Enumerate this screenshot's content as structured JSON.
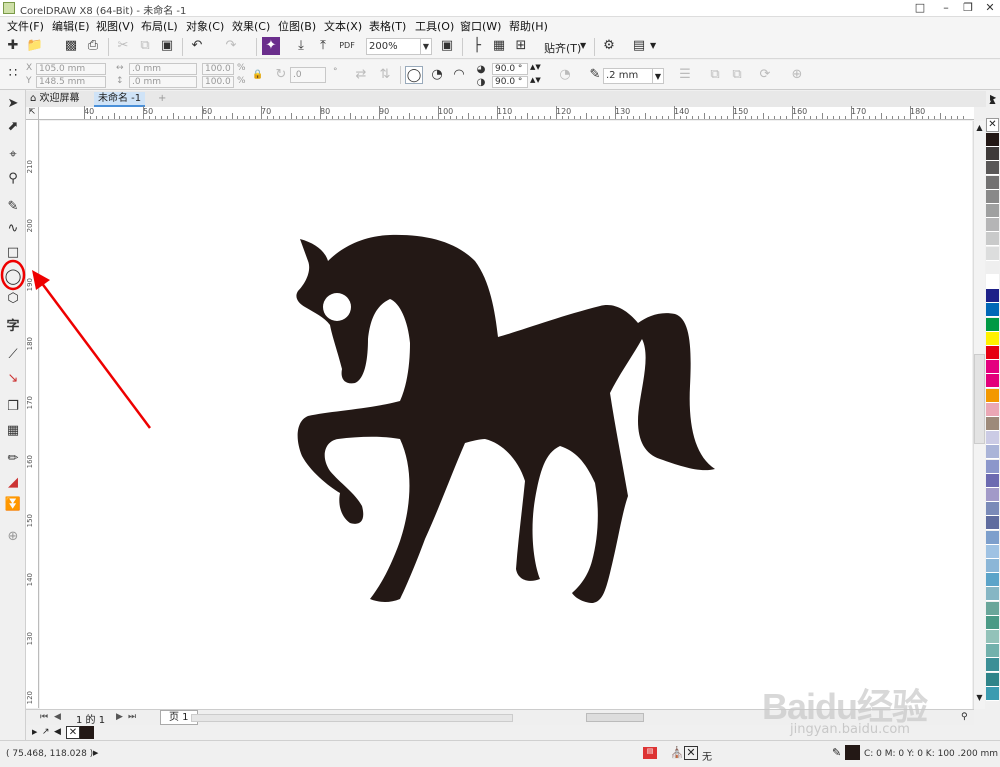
{
  "titlebar": {
    "title": "CorelDRAW X8 (64-Bit) - 未命名 -1"
  },
  "menu": [
    "文件(F)",
    "编辑(E)",
    "视图(V)",
    "布局(L)",
    "对象(C)",
    "效果(C)",
    "位图(B)",
    "文本(X)",
    "表格(T)",
    "工具(O)",
    "窗口(W)",
    "帮助(H)"
  ],
  "toolbar": {
    "zoom": "200%",
    "snap_label": "贴齐(T)"
  },
  "props": {
    "x": "105.0 mm",
    "y": "148.5 mm",
    "w": ".0 mm",
    "h": ".0 mm",
    "sx": "100.0",
    "sy": "100.0",
    "pct": "%",
    "rot": ".0",
    "start_angle": "90.0 °",
    "end_angle": "90.0 °",
    "outline": ".2 mm"
  },
  "tabs": {
    "welcome": "欢迎屏幕",
    "doc": "未命名 -1"
  },
  "hruler": [
    "40",
    "50",
    "60",
    "70",
    "80",
    "90",
    "100",
    "110",
    "120",
    "130",
    "140",
    "150",
    "160",
    "170",
    "180"
  ],
  "vruler": [
    "210",
    "200",
    "190",
    "180",
    "170",
    "160",
    "150",
    "140",
    "130",
    "120",
    "110"
  ],
  "pagebar": {
    "page_count": "1 的 1",
    "page_tab": "页 1"
  },
  "status": {
    "coords": "( 75.468, 118.028 )",
    "fill_none": "无",
    "color_info": "C: 0 M: 0 Y: 0 K: 100  .200 mm"
  },
  "palette": [
    "#231815",
    "#3e3a39",
    "#595757",
    "#727171",
    "#898989",
    "#9fa0a0",
    "#b5b5b6",
    "#c9caca",
    "#dcdddd",
    "#efefef",
    "#ffffff",
    "#1d2088",
    "#0068b7",
    "#009944",
    "#fff100",
    "#e60012",
    "#e4007f",
    "#e3007b",
    "#f39800",
    "#eaa7b5",
    "#9d8a7a",
    "#cbcbe5",
    "#aab4d8",
    "#8c97cb",
    "#6c6ab1",
    "#a29ac8",
    "#7a8ab8",
    "#5f6c9f",
    "#7d9fcc",
    "#9fc2e3",
    "#8bb6d7",
    "#5ca4c9",
    "#86b6c4",
    "#6aa69a",
    "#4b9a86",
    "#93c2b9",
    "#72b1ac",
    "#3c8f96",
    "#2f8489",
    "#3b9bb0"
  ],
  "watermark": {
    "logo": "Baidu经验",
    "url": "jingyan.baidu.com"
  }
}
